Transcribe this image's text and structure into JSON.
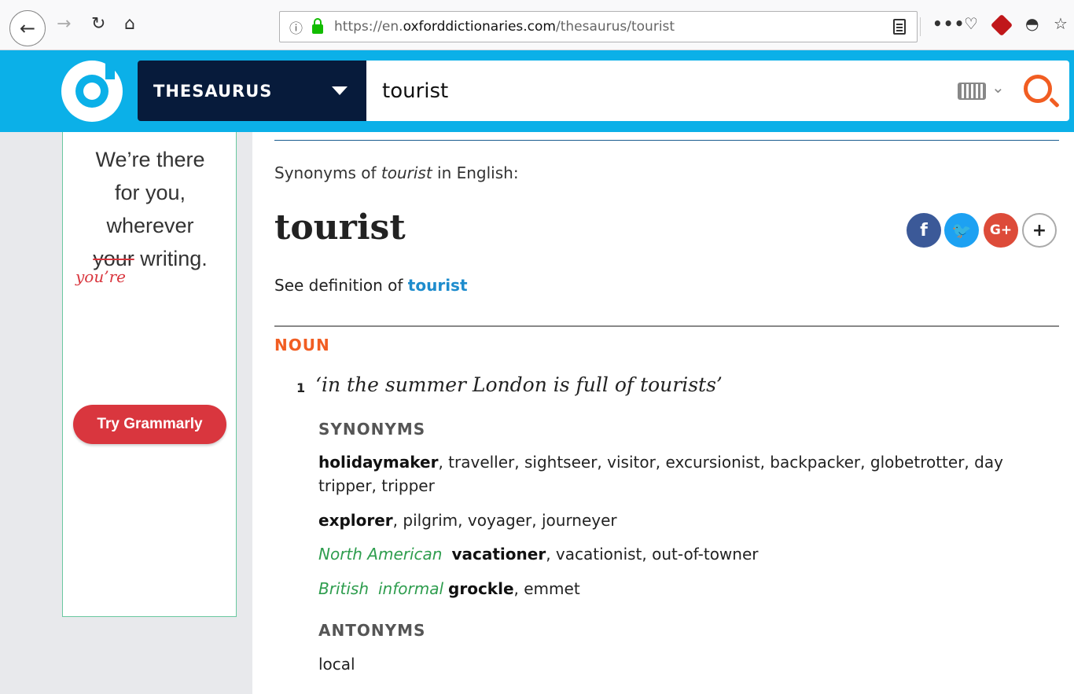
{
  "browser": {
    "url_scheme": "https://en.",
    "url_domain": "oxforddictionaries.com",
    "url_path": "/thesaurus/tourist",
    "more_label": "•••"
  },
  "header": {
    "dictionary_select": "THESAURUS",
    "search_value": "tourist",
    "accent_color": "#0bb0e8",
    "brand_dark": "#071b3b",
    "search_icon_color": "#f15d22"
  },
  "ad": {
    "line1": "We’re there",
    "line2": "for you,",
    "line3": "wherever",
    "struck_word": "your",
    "line4_rest": " writing.",
    "correction": "you’re",
    "button_label": "Try Grammarly"
  },
  "entry": {
    "intro_prefix": "Synonyms of ",
    "intro_word": "tourist",
    "intro_suffix": " in English:",
    "headword": "tourist",
    "see_def_prefix": "See definition of ",
    "see_def_link": "tourist",
    "part_of_speech": "NOUN",
    "sense_number": "1",
    "example": "‘in the summer London is full of tourists’",
    "synonyms_label": "SYNONYMS",
    "syn1_head": "holidaymaker",
    "syn1_rest": ", traveller, sightseer, visitor, excursionist, backpacker, globetrotter, day tripper, tripper",
    "syn2_head": "explorer",
    "syn2_rest": ", pilgrim, voyager, journeyer",
    "syn3_region": "North American",
    "syn3_head": "vacationer",
    "syn3_rest": ", vacationist, out-of-towner",
    "syn4_region1": "British",
    "syn4_region2": "informal",
    "syn4_head": "grockle",
    "syn4_rest": ", emmet",
    "antonyms_label": "ANTONYMS",
    "antonym1": "local"
  },
  "share": {
    "facebook": "f",
    "twitter": "t",
    "googleplus": "G+",
    "more": "+"
  }
}
